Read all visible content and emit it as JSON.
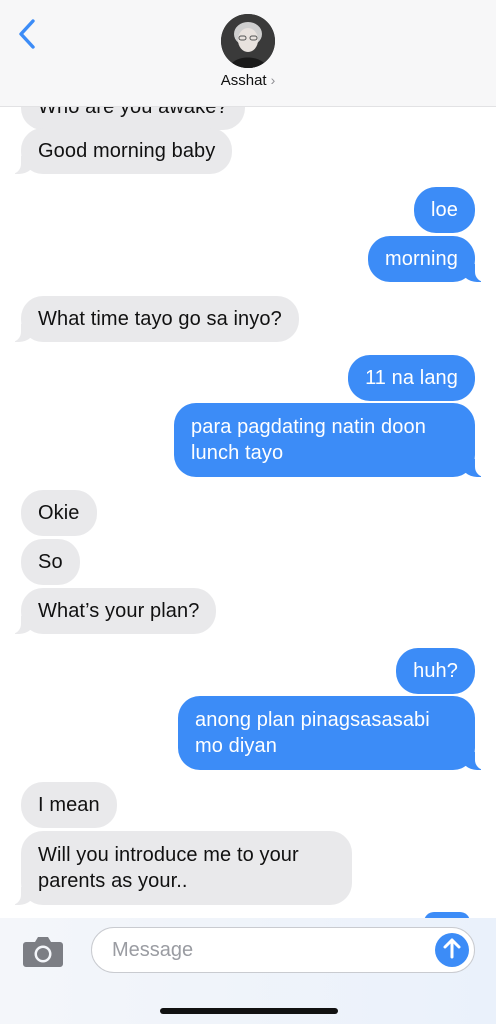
{
  "header": {
    "contact_name": "Asshat",
    "contact_chevron": "›",
    "back_icon": "chevron-left-icon",
    "accent_color": "#3c8cf7"
  },
  "messages": [
    {
      "direction": "incoming",
      "text": "Who are you awake?",
      "partially_hidden": true
    },
    {
      "direction": "incoming",
      "text": "Good morning baby"
    },
    {
      "direction": "outgoing",
      "text": "loe"
    },
    {
      "direction": "outgoing",
      "text": "morning"
    },
    {
      "direction": "incoming",
      "text": "What time tayo go sa inyo?"
    },
    {
      "direction": "outgoing",
      "text": "11 na lang"
    },
    {
      "direction": "outgoing",
      "text": "para pagdating natin doon lunch tayo"
    },
    {
      "direction": "incoming",
      "text": "Okie"
    },
    {
      "direction": "incoming",
      "text": "So"
    },
    {
      "direction": "incoming",
      "text": "What’s your plan?"
    },
    {
      "direction": "outgoing",
      "text": "huh?"
    },
    {
      "direction": "outgoing",
      "text": "anong plan pinagsasasabi mo diyan"
    },
    {
      "direction": "incoming",
      "text": "I mean"
    },
    {
      "direction": "incoming",
      "text": "Will you introduce me to your parents as your.."
    }
  ],
  "composer": {
    "placeholder": "Message",
    "value": "",
    "camera_icon": "camera-icon",
    "send_icon": "arrow-up-icon"
  },
  "colors": {
    "incoming_bubble": "#e9e9eb",
    "outgoing_bubble": "#3c8cf7",
    "header_bg": "#f7f7f8"
  }
}
